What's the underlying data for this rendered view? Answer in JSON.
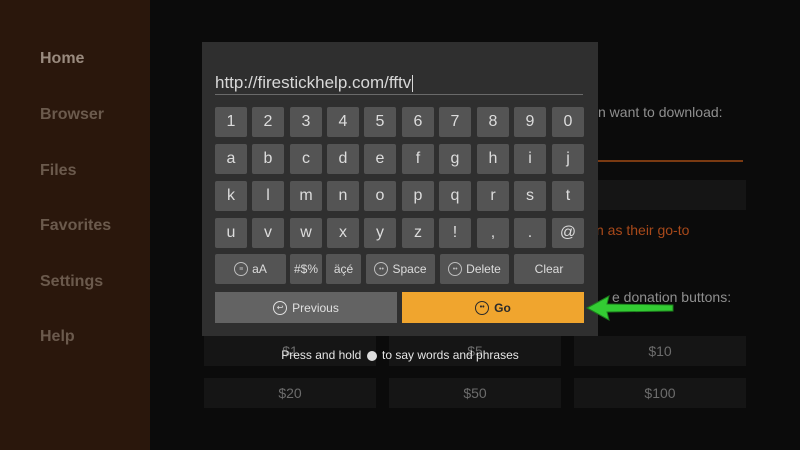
{
  "sidebar": {
    "items": [
      {
        "label": "Home"
      },
      {
        "label": "Browser"
      },
      {
        "label": "Files"
      },
      {
        "label": "Favorites"
      },
      {
        "label": "Settings"
      },
      {
        "label": "Help"
      }
    ]
  },
  "background": {
    "download_prompt": "n want to download:",
    "goto_text": "n as their go-to",
    "donation_text": "e donation buttons:",
    "donations": [
      "$1",
      "$5",
      "$10",
      "$20",
      "$50",
      "$100"
    ]
  },
  "keyboard": {
    "url_value": "http://firestickhelp.com/fftv",
    "rows": [
      [
        "1",
        "2",
        "3",
        "4",
        "5",
        "6",
        "7",
        "8",
        "9",
        "0"
      ],
      [
        "a",
        "b",
        "c",
        "d",
        "e",
        "f",
        "g",
        "h",
        "i",
        "j"
      ],
      [
        "k",
        "l",
        "m",
        "n",
        "o",
        "p",
        "q",
        "r",
        "s",
        "t"
      ],
      [
        "u",
        "v",
        "w",
        "x",
        "y",
        "z",
        "!",
        ",",
        ".",
        "@"
      ]
    ],
    "func_keys": {
      "case": "aA",
      "symbols": "#$%",
      "accents": "äçé",
      "space": "Space",
      "delete": "Delete",
      "clear": "Clear"
    },
    "previous_label": "Previous",
    "go_label": "Go",
    "hint_before": "Press and hold",
    "hint_after": "to say words and phrases"
  },
  "colors": {
    "accent": "#f0a52e",
    "arrow": "#33cc33",
    "sidebar": "#2a170c"
  }
}
